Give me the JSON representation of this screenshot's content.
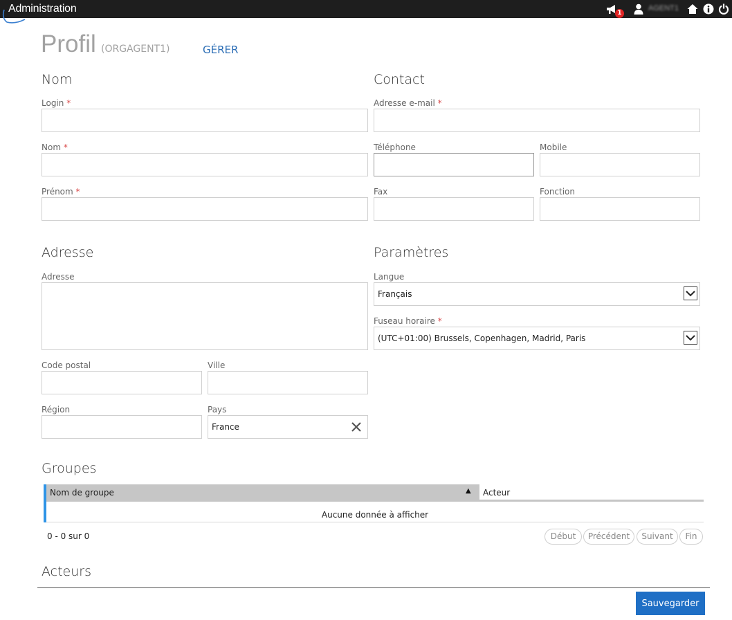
{
  "app": {
    "title": "Administration"
  },
  "topbar": {
    "notification_count": "1",
    "user_name": "AGENT1",
    "icons": [
      "megaphone-icon",
      "user-icon",
      "home-icon",
      "info-icon",
      "power-icon"
    ]
  },
  "header": {
    "title": "Profil",
    "subtitle": "(ORGAGENT1)",
    "manage_link": "GÉRER"
  },
  "nom": {
    "heading": "Nom",
    "login_label": "Login",
    "nom_label": "Nom",
    "prenom_label": "Prénom",
    "required_mark": "*"
  },
  "contact": {
    "heading": "Contact",
    "email_label": "Adresse e-mail",
    "phone_label": "Téléphone",
    "mobile_label": "Mobile",
    "fax_label": "Fax",
    "function_label": "Fonction"
  },
  "adresse": {
    "heading": "Adresse",
    "address_label": "Adresse",
    "postal_label": "Code postal",
    "city_label": "Ville",
    "region_label": "Région",
    "country_label": "Pays",
    "country_value": "France"
  },
  "parametres": {
    "heading": "Paramètres",
    "language_label": "Langue",
    "language_value": "Français",
    "timezone_label": "Fuseau horaire",
    "timezone_value": "(UTC+01:00) Brussels, Copenhagen, Madrid, Paris"
  },
  "groupes": {
    "heading": "Groupes",
    "columns": [
      "Nom de groupe",
      "Acteur"
    ],
    "empty_text": "Aucune donnée à afficher",
    "pager_info": "0 - 0 sur 0",
    "pager_buttons": [
      "Début",
      "Précédent",
      "Suivant",
      "Fin"
    ]
  },
  "acteurs": {
    "heading": "Acteurs"
  },
  "footer": {
    "save_label": "Sauvegarder"
  },
  "colors": {
    "topbar": "#1e1e1e",
    "accent": "#1f6fc5",
    "grid_accent": "#2f94e6",
    "badge": "#e02424"
  }
}
